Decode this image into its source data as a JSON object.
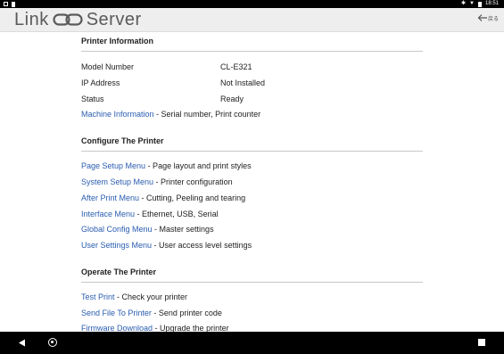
{
  "status_bar": {
    "time": "18:51"
  },
  "app": {
    "brand_left": "Link",
    "brand_right": "Server",
    "back_label": "戻る"
  },
  "sections": {
    "printer_info": {
      "title": "Printer Information",
      "rows": [
        {
          "label": "Model Number",
          "value": "CL-E321"
        },
        {
          "label": "IP Address",
          "value": "Not Installed"
        },
        {
          "label": "Status",
          "value": "Ready"
        }
      ],
      "machine_link": "Machine Information",
      "machine_desc": " - Serial number, Print counter"
    },
    "configure": {
      "title": "Configure The Printer",
      "items": [
        {
          "link": "Page Setup Menu",
          "desc": " - Page layout and print styles"
        },
        {
          "link": "System Setup Menu",
          "desc": " - Printer configuration"
        },
        {
          "link": "After Print Menu",
          "desc": " - Cutting, Peeling and tearing"
        },
        {
          "link": "Interface Menu",
          "desc": " - Ethernet, USB, Serial"
        },
        {
          "link": "Global Config Menu",
          "desc": " - Master settings"
        },
        {
          "link": "User Settings Menu",
          "desc": " - User access level settings"
        }
      ]
    },
    "operate": {
      "title": "Operate The Printer",
      "items": [
        {
          "link": "Test Print",
          "desc": " - Check your printer"
        },
        {
          "link": "Send File To Printer",
          "desc": " - Send printer code"
        },
        {
          "link": "Firmware Download",
          "desc": " - Upgrade the printer"
        }
      ]
    }
  }
}
